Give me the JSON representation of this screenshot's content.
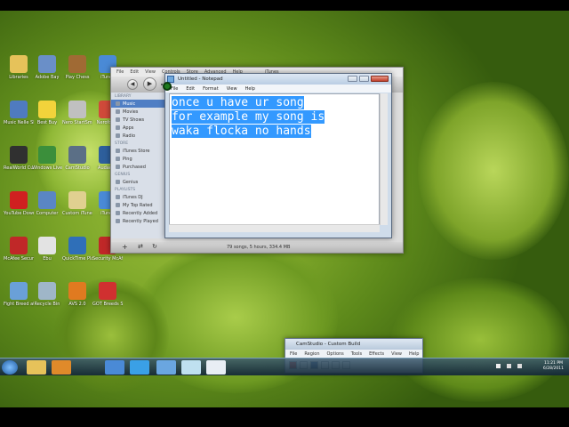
{
  "desktop_icons": [
    {
      "label": "Libraries",
      "color": "#e6c25a"
    },
    {
      "label": "Adobe Bay",
      "color": "#6a8fc8"
    },
    {
      "label": "Play Chess",
      "color": "#a06a34"
    },
    {
      "label": "iTunes",
      "color": "#4a8ad6"
    },
    {
      "label": "Music Nelle Skelpus",
      "color": "#4f7bc0"
    },
    {
      "label": "Best Buy",
      "color": "#f2d33b"
    },
    {
      "label": "Nero StartSmart",
      "color": "#c0c0c0"
    },
    {
      "label": "Neroforce",
      "color": "#d04a3a"
    },
    {
      "label": "RealWorld Cursor Editor",
      "color": "#303030"
    },
    {
      "label": "Windows Live Messenger",
      "color": "#3b8f3b"
    },
    {
      "label": "CamStudio",
      "color": "#5b6f86"
    },
    {
      "label": "Audacity",
      "color": "#2e5f9c"
    },
    {
      "label": "YouTube Downloader",
      "color": "#d02020"
    },
    {
      "label": "Computer",
      "color": "#5a86c4"
    },
    {
      "label": "Custom iTunes",
      "color": "#e0d090"
    },
    {
      "label": "iTunes",
      "color": "#4a8ad6"
    },
    {
      "label": "McAfee Security Sc.",
      "color": "#c02828"
    },
    {
      "label": "Ebu",
      "color": "#e3e3e3"
    },
    {
      "label": "QuickTime Player",
      "color": "#2f6fb8"
    },
    {
      "label": "Security McAfee",
      "color": "#c02828"
    },
    {
      "label": "Fight Breed at the Global",
      "color": "#6aa0d8"
    },
    {
      "label": "Recycle Bin",
      "color": "#9fb6c8"
    },
    {
      "label": "AVS 2.0",
      "color": "#e07a20"
    },
    {
      "label": "GOT Breeds Shoulders",
      "color": "#d03030"
    }
  ],
  "itunes": {
    "menu": [
      "File",
      "Edit",
      "View",
      "Controls",
      "Store",
      "Advanced",
      "Help"
    ],
    "title": "iTunes",
    "sidebar": {
      "library_header": "LIBRARY",
      "library": [
        "Music",
        "Movies",
        "TV Shows",
        "Apps",
        "Radio"
      ],
      "store_header": "STORE",
      "store": [
        "iTunes Store",
        "Ping",
        "Purchased"
      ],
      "genius_header": "GENIUS",
      "genius": [
        "Genius"
      ],
      "playlists_header": "PLAYLISTS",
      "playlists": [
        "iTunes DJ",
        "My Top Rated",
        "Recently Added",
        "Recently Played"
      ]
    },
    "status": "79 songs, 5 hours, 334.4 MB"
  },
  "notepad": {
    "title": "Untitled - Notepad",
    "menu": [
      "File",
      "Edit",
      "Format",
      "View",
      "Help"
    ],
    "lines": [
      "once u have ur song",
      "for example my song is",
      "waka flocka no hands"
    ]
  },
  "camstudio": {
    "title": "CamStudio - Custom Build",
    "menu": [
      "File",
      "Region",
      "Options",
      "Tools",
      "Effects",
      "View",
      "Help"
    ]
  },
  "taskbar": {
    "clock_time": "11:21 PM",
    "clock_date": "6/28/2011"
  },
  "colors": {
    "selection": "#3399ff",
    "taskbar": "#2a4a5e",
    "itunes_selected": "#4f7ec4"
  }
}
